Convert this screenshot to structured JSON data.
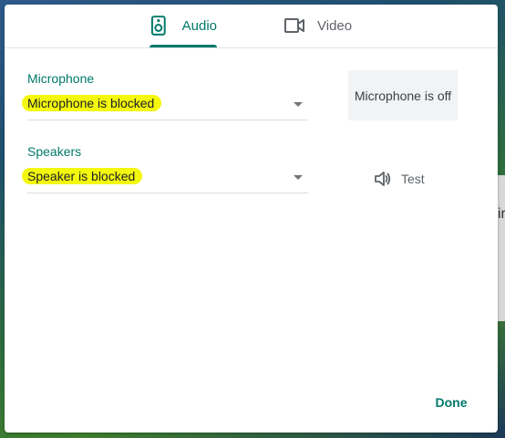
{
  "tabs": [
    {
      "label": "Audio",
      "selected": true,
      "icon": "speaker-icon"
    },
    {
      "label": "Video",
      "selected": false,
      "icon": "video-camera-icon"
    }
  ],
  "microphone": {
    "label": "Microphone",
    "value": "Microphone is blocked",
    "status": "Microphone is off"
  },
  "speakers": {
    "label": "Speakers",
    "value": "Speaker is blocked",
    "test_label": "Test"
  },
  "footer": {
    "done_label": "Done"
  },
  "backdrop": {
    "partial_glyph": "ir"
  },
  "colors": {
    "accent": "#00796b",
    "highlight": "#f3f80c"
  }
}
